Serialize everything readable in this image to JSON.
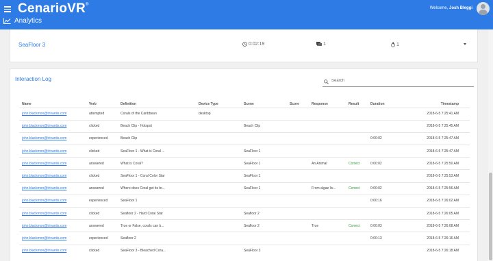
{
  "header": {
    "logo": "CenarioVR",
    "logo_mark": "®",
    "page_title": "Analytics",
    "welcome_text": "Welcome,",
    "user_name": "Josh Bleggi"
  },
  "scene_card": {
    "name": "SeaFloor 3",
    "duration": "0:02:19",
    "interactions": "1",
    "score": "1"
  },
  "interaction_log": {
    "title": "Interaction Log",
    "search_placeholder": "Search",
    "columns": [
      "Name",
      "Verb",
      "Definition",
      "Device Type",
      "Scene",
      "Score",
      "Response",
      "Result",
      "Duration",
      "Timestamp"
    ],
    "rows": [
      {
        "name": "john.blackmon@trivantis.com",
        "verb": "attempted",
        "definition": "Corals of the Caribbean",
        "device": "desktop",
        "scene": "",
        "score": "",
        "response": "",
        "result": "",
        "duration": "",
        "timestamp": "2018-6-5 7:25:41 AM"
      },
      {
        "name": "john.blackmon@trivantis.com",
        "verb": "clicked",
        "definition": "Beach Clip - Hotspot",
        "device": "",
        "scene": "Beach Clip",
        "score": "",
        "response": "",
        "result": "",
        "duration": "",
        "timestamp": "2018-6-5 7:25:45 AM"
      },
      {
        "name": "john.blackmon@trivantis.com",
        "verb": "experienced",
        "definition": "Beach Clip",
        "device": "",
        "scene": "",
        "score": "",
        "response": "",
        "result": "",
        "duration": "0:00:02",
        "timestamp": "2018-6-5 7:25:47 AM"
      },
      {
        "name": "john.blackmon@trivantis.com",
        "verb": "clicked",
        "definition": "SeaFloor 1 - What is Coral ...",
        "device": "",
        "scene": "SeaFloor 1",
        "score": "",
        "response": "",
        "result": "",
        "duration": "",
        "timestamp": "2018-6-5 7:25:47 AM"
      },
      {
        "name": "john.blackmon@trivantis.com",
        "verb": "answered",
        "definition": "What is Coral?",
        "device": "",
        "scene": "SeaFloor 1",
        "score": "",
        "response": "An Animal",
        "result": "Correct",
        "duration": "0:00:02",
        "timestamp": "2018-6-5 7:25:50 AM"
      },
      {
        "name": "john.blackmon@trivantis.com",
        "verb": "clicked",
        "definition": "SeaFloor 1 - Coral Color Star",
        "device": "",
        "scene": "SeaFloor 1",
        "score": "",
        "response": "",
        "result": "",
        "duration": "",
        "timestamp": "2018-6-5 7:25:53 AM"
      },
      {
        "name": "john.blackmon@trivantis.com",
        "verb": "answered",
        "definition": "Where does Coral get its br...",
        "device": "",
        "scene": "SeaFloor 1",
        "score": "",
        "response": "From algae liv...",
        "result": "Correct",
        "duration": "0:00:02",
        "timestamp": "2018-6-5 7:25:56 AM"
      },
      {
        "name": "john.blackmon@trivantis.com",
        "verb": "experienced",
        "definition": "SeaFloor 1",
        "device": "",
        "scene": "",
        "score": "",
        "response": "",
        "result": "",
        "duration": "0:00:16",
        "timestamp": "2018-6-5 7:26:02 AM"
      },
      {
        "name": "john.blackmon@trivantis.com",
        "verb": "clicked",
        "definition": "Seafloor 2 - Hard Coral Star",
        "device": "",
        "scene": "Seafloor 2",
        "score": "",
        "response": "",
        "result": "",
        "duration": "",
        "timestamp": "2018-6-5 7:26:05 AM"
      },
      {
        "name": "john.blackmon@trivantis.com",
        "verb": "answered",
        "definition": "True or False, corals can b...",
        "device": "",
        "scene": "Seafloor 2",
        "score": "",
        "response": "True",
        "result": "Correct",
        "duration": "0:00:03",
        "timestamp": "2018-6-5 7:26:08 AM"
      },
      {
        "name": "john.blackmon@trivantis.com",
        "verb": "experienced",
        "definition": "Seafloor 2",
        "device": "",
        "scene": "",
        "score": "",
        "response": "",
        "result": "",
        "duration": "0:00:13",
        "timestamp": "2018-6-5 7:26:16 AM"
      },
      {
        "name": "john.blackmon@trivantis.com",
        "verb": "clicked",
        "definition": "SeaFloor 3 - Bleached Cora...",
        "device": "",
        "scene": "SeaFloor 3",
        "score": "",
        "response": "",
        "result": "",
        "duration": "",
        "timestamp": "2018-6-5 7:26:18 AM"
      }
    ]
  },
  "colors": {
    "header_bg": "#2f7be6",
    "link": "#2f7be6",
    "correct": "#2e9a3d"
  }
}
